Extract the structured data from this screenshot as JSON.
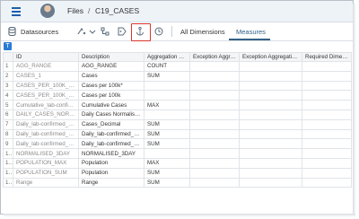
{
  "breadcrumb": {
    "root": "Files",
    "separator": "/",
    "current": "C19_CASES"
  },
  "toolbar": {
    "datasources_label": "Datasources",
    "tab_all": "All Dimensions",
    "tab_measures": "Measures",
    "filter_button": "T"
  },
  "table": {
    "headers": [
      "",
      "ID",
      "Description",
      "Aggregation Ty...",
      "Exception Aggre...",
      "Exception Aggregation ...",
      "Required Dimensi..."
    ],
    "rows": [
      {
        "n": "1",
        "id": "AGG_RANGE",
        "desc": "AGG_RANGE",
        "agg": "COUNT"
      },
      {
        "n": "2",
        "id": "CASES_1",
        "desc": "Cases",
        "agg": "SUM"
      },
      {
        "n": "3",
        "id": "CASES_PER_100K_AGG",
        "desc": "Cases per 100k*",
        "agg": ""
      },
      {
        "n": "4",
        "id": "CASES_PER_100K_DAY",
        "desc": "Cases per 100k",
        "agg": ""
      },
      {
        "n": "5",
        "id": "Cumulative_lab-confirme...",
        "desc": "Cumulative Cases",
        "agg": "MAX"
      },
      {
        "n": "6",
        "id": "DAILY_CASES_NORMAL...",
        "desc": "Daily Cases Normalised",
        "agg": ""
      },
      {
        "n": "7",
        "id": "Daily_lab-confirmed_ca...",
        "desc": "Cases_Decimal",
        "agg": "SUM"
      },
      {
        "n": "8",
        "id": "Daily_lab-confirmed_ca...",
        "desc": "Daily_lab-confirmed_ca...",
        "agg": "SUM"
      },
      {
        "n": "9",
        "id": "Daily_lab-confirmed_ca...",
        "desc": "Daily_lab-confirmed_ca...",
        "agg": "SUM"
      },
      {
        "n": "10",
        "id": "NORMALISED_3DAY",
        "desc": "NORMALISED_3DAY",
        "agg": ""
      },
      {
        "n": "11",
        "id": "POPULATION_MAX",
        "desc": "Population",
        "agg": "MAX"
      },
      {
        "n": "12",
        "id": "POPULATION_SUM",
        "desc": "Population",
        "agg": "SUM"
      },
      {
        "n": "13",
        "id": "Range",
        "desc": "Range",
        "agg": "SUM"
      }
    ]
  },
  "colors": {
    "accent": "#346187",
    "highlight": "#d9352c",
    "filter_btn": "#2a7bd1"
  }
}
